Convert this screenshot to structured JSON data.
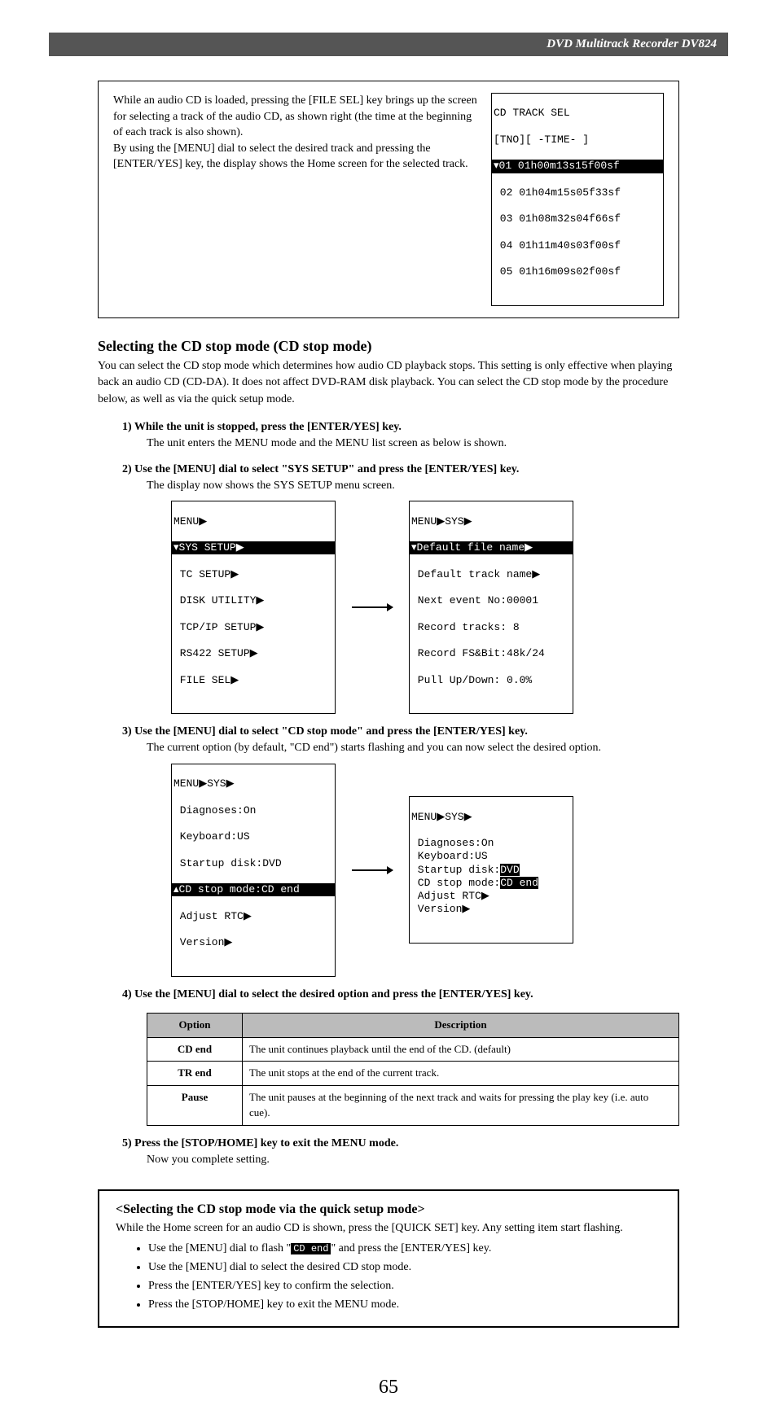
{
  "header": "DVD Multitrack Recorder DV824",
  "box1": {
    "p1": "While an audio CD is loaded, pressing the [FILE SEL] key brings up the screen for selecting a track of the audio CD, as shown right (the time at the beginning of each track is also shown).",
    "p2": "By using the [MENU] dial to select the desired track and pressing the [ENTER/YES] key, the display shows the Home screen for the selected track."
  },
  "lcd_tracksel": {
    "title": "CD TRACK SEL",
    "header": "[TNO][ -TIME- ]",
    "rows": [
      "▾01 01h00m13s15f00sf",
      " 02 01h04m15s05f33sf",
      " 03 01h08m32s04f66sf",
      " 04 01h11m40s03f00sf",
      " 05 01h16m09s02f00sf"
    ],
    "selected": 0
  },
  "sec_title": "Selecting the CD stop mode (CD stop mode)",
  "sec_para": "You can select the CD stop mode which determines how audio CD playback stops. This setting is only effective when playing back an audio CD (CD-DA). It does not affect DVD-RAM disk playback. You can select the CD stop mode by the procedure below, as well as via the quick setup mode.",
  "steps": {
    "s1": {
      "head": "1) While the unit is stopped, press the [ENTER/YES] key.",
      "body": "The unit enters the MENU mode and the MENU list screen as below is shown."
    },
    "s2": {
      "head": "2) Use the [MENU] dial to select \"SYS SETUP\" and press the [ENTER/YES] key.",
      "body": "The display now shows the SYS SETUP menu screen."
    },
    "s3": {
      "head": "3) Use the [MENU] dial to select \"CD stop mode\" and press the [ENTER/YES] key.",
      "body": "The current option (by default, \"CD end\") starts flashing and you can now select the desired option."
    },
    "s4": {
      "head": "4) Use the [MENU] dial to select the desired option and press the [ENTER/YES] key.",
      "body": ""
    },
    "s5": {
      "head": "5) Press the [STOP/HOME] key to exit the MENU mode.",
      "body": "Now you complete setting."
    }
  },
  "lcd_menu": {
    "title": "MENU▶",
    "rows": [
      "▾SYS SETUP▶",
      " TC SETUP▶",
      " DISK UTILITY▶",
      " TCP/IP SETUP▶",
      " RS422 SETUP▶",
      " FILE SEL▶"
    ],
    "selected": 0
  },
  "lcd_sys1": {
    "title": "MENU▶SYS▶",
    "rows": [
      "▾Default file name▶",
      " Default track name▶",
      " Next event No:00001",
      " Record tracks: 8",
      " Record FS&Bit:48k/24",
      " Pull Up/Down: 0.0%"
    ],
    "selected": 0
  },
  "lcd_sys2a": {
    "title": "MENU▶SYS▶",
    "rows": [
      " Diagnoses:On",
      " Keyboard:US",
      " Startup disk:DVD",
      "▴CD stop mode:CD end",
      " Adjust RTC▶",
      " Version▶"
    ],
    "selected": 3
  },
  "lcd_sys2b": {
    "title": "MENU▶SYS▶",
    "pre": " Diagnoses:On\n Keyboard:US\n Startup disk:",
    "mid_inv": "DVD",
    "line4a": " CD stop mode:",
    "line4b": "CD end",
    "post": " Adjust RTC▶\n Version▶"
  },
  "options_table": {
    "h1": "Option",
    "h2": "Description",
    "rows": [
      {
        "name": "CD end",
        "desc": "The unit continues playback until the end of the CD. (default)"
      },
      {
        "name": "TR end",
        "desc": "The unit stops at the end of the current track."
      },
      {
        "name": "Pause",
        "desc": "The unit pauses at the beginning of the next track and waits for pressing the play key (i.e. auto cue)."
      }
    ]
  },
  "midbox": {
    "sub": "<Selecting the CD stop mode via the quick setup mode>",
    "intro": "While the Home screen for an audio CD is shown, press the [QUICK SET] key. Any setting item start flashing.",
    "b1a": "Use the [MENU] dial to flash \"",
    "b1_inv": "CD end",
    "b1b": "\" and press the [ENTER/YES] key.",
    "b2": "Use the [MENU] dial to select the desired CD stop mode.",
    "b3": "Press the [ENTER/YES] key to confirm the selection.",
    "b4": "Press the [STOP/HOME] key to exit the MENU mode."
  },
  "page_num": "65"
}
